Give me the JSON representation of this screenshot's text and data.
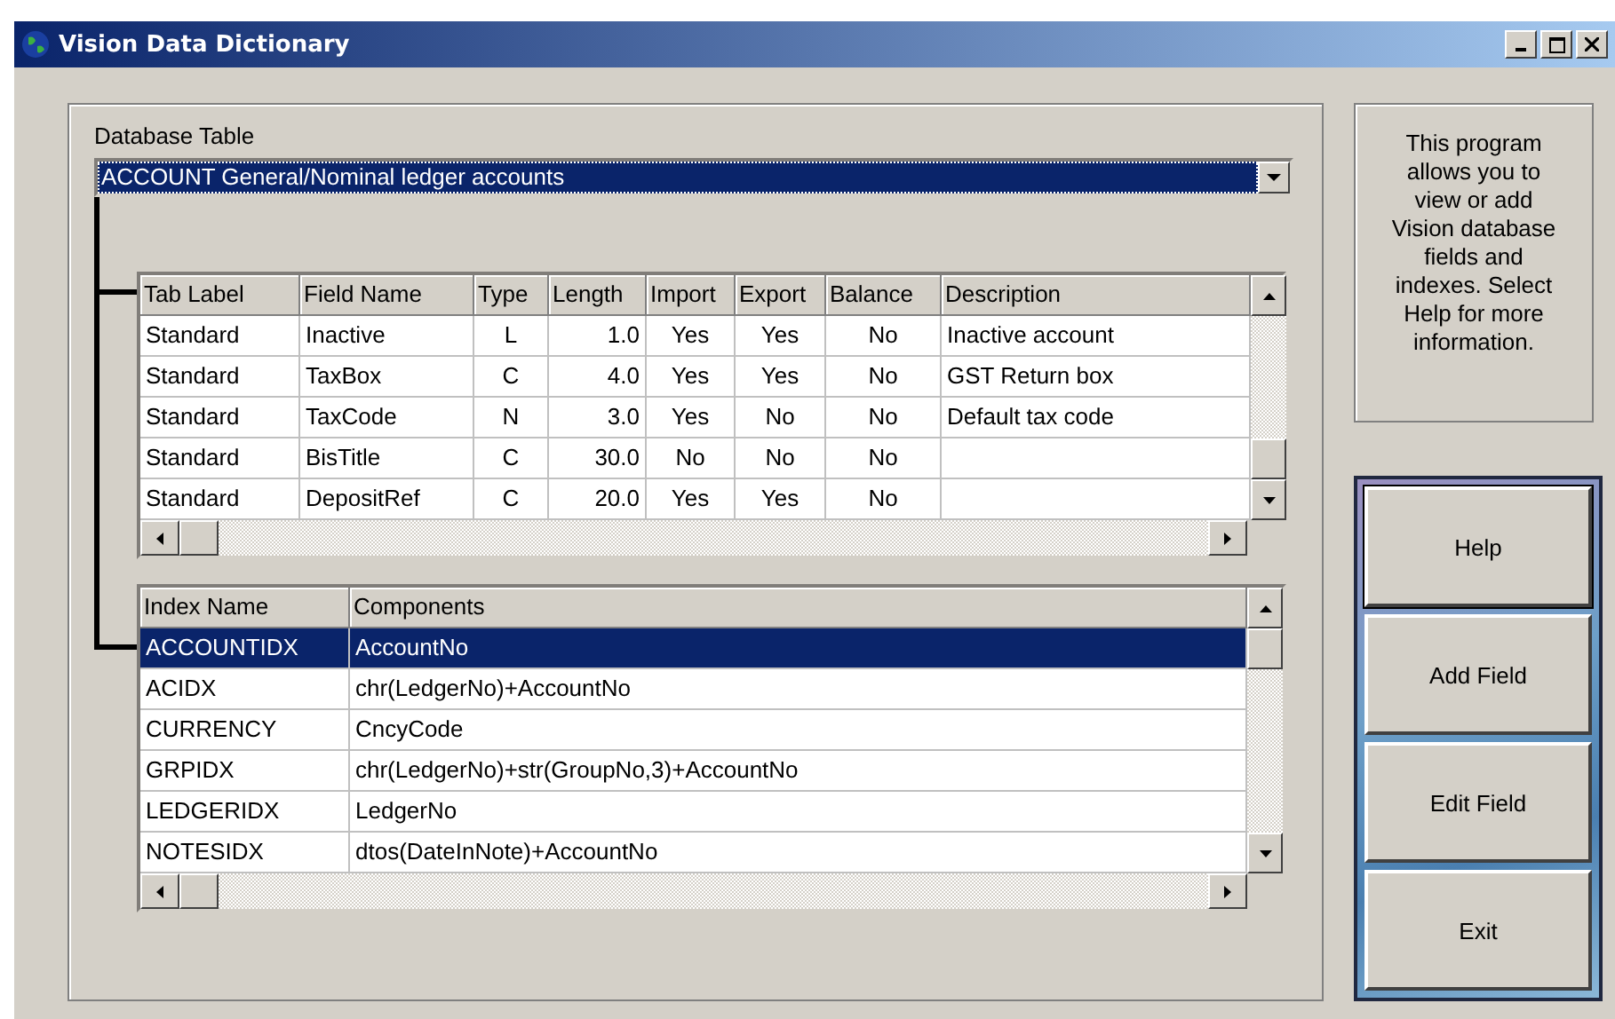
{
  "window": {
    "title": "Vision Data Dictionary"
  },
  "database_table": {
    "label": "Database Table",
    "value": "ACCOUNT  General/Nominal ledger accounts"
  },
  "fields_table": {
    "columns": [
      "Tab Label",
      "Field Name",
      "Type",
      "Length",
      "Import",
      "Export",
      "Balance",
      "Description"
    ],
    "rows": [
      [
        "Standard",
        "Inactive",
        "L",
        "1.0",
        "Yes",
        "Yes",
        "No",
        "Inactive account"
      ],
      [
        "Standard",
        "TaxBox",
        "C",
        "4.0",
        "Yes",
        "Yes",
        "No",
        "GST Return box"
      ],
      [
        "Standard",
        "TaxCode",
        "N",
        "3.0",
        "Yes",
        "No",
        "No",
        "Default tax code"
      ],
      [
        "Standard",
        "BisTitle",
        "C",
        "30.0",
        "No",
        "No",
        "No",
        ""
      ],
      [
        "Standard",
        "DepositRef",
        "C",
        "20.0",
        "Yes",
        "Yes",
        "No",
        ""
      ]
    ]
  },
  "index_table": {
    "columns": [
      "Index Name",
      "Components"
    ],
    "rows": [
      {
        "cells": [
          "ACCOUNTIDX",
          "AccountNo"
        ],
        "selected": true
      },
      {
        "cells": [
          "ACIDX",
          "chr(LedgerNo)+AccountNo"
        ],
        "selected": false
      },
      {
        "cells": [
          "CURRENCY",
          "CncyCode"
        ],
        "selected": false
      },
      {
        "cells": [
          "GRPIDX",
          "chr(LedgerNo)+str(GroupNo,3)+AccountNo"
        ],
        "selected": false
      },
      {
        "cells": [
          "LEDGERIDX",
          "LedgerNo"
        ],
        "selected": false
      },
      {
        "cells": [
          "NOTESIDX",
          "dtos(DateInNote)+AccountNo"
        ],
        "selected": false
      }
    ]
  },
  "info_text": "This program allows you to view or add Vision database fields and indexes. Select Help for more information.",
  "buttons": [
    {
      "label": "Help",
      "default": true
    },
    {
      "label": "Add Field",
      "default": false
    },
    {
      "label": "Edit Field",
      "default": false
    },
    {
      "label": "Exit",
      "default": false
    }
  ]
}
